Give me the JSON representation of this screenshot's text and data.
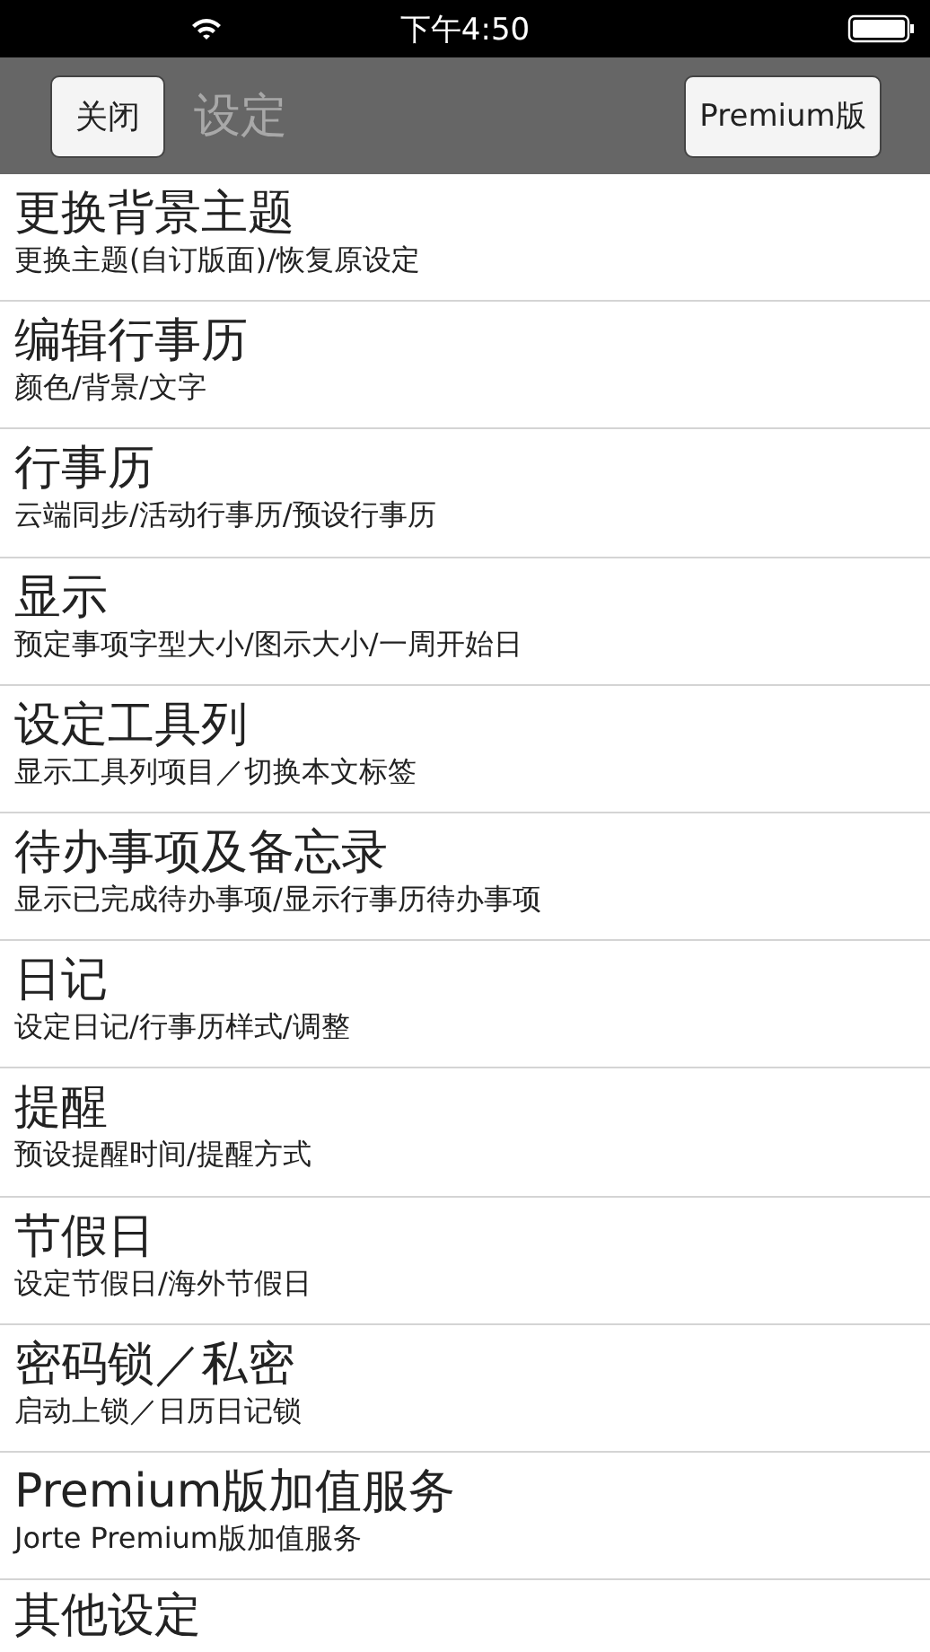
{
  "status_bar": {
    "time": "下午4:50"
  },
  "nav_bar": {
    "close_button": "关闭",
    "title": "设定",
    "premium_button": "Premium版"
  },
  "items": [
    {
      "title": "更换背景主题",
      "subtitle": "更换主题(自订版面)/恢复原设定"
    },
    {
      "title": "编辑行事历",
      "subtitle": "颜色/背景/文字"
    },
    {
      "title": "行事历",
      "subtitle": "云端同步/活动行事历/预设行事历"
    },
    {
      "title": "显示",
      "subtitle": "预定事项字型大小/图示大小/一周开始日"
    },
    {
      "title": "设定工具列",
      "subtitle": "显示工具列项目／切换本文标签"
    },
    {
      "title": "待办事项及备忘录",
      "subtitle": "显示已完成待办事项/显示行事历待办事项"
    },
    {
      "title": "日记",
      "subtitle": "设定日记/行事历样式/调整"
    },
    {
      "title": "提醒",
      "subtitle": "预设提醒时间/提醒方式"
    },
    {
      "title": "节假日",
      "subtitle": "设定节假日/海外节假日"
    },
    {
      "title": "密码锁／私密",
      "subtitle": "启动上锁／日历日记锁"
    },
    {
      "title": "Premium版加值服务",
      "subtitle": "Jorte Premium版加值服务"
    },
    {
      "title": "其他设定"
    }
  ]
}
